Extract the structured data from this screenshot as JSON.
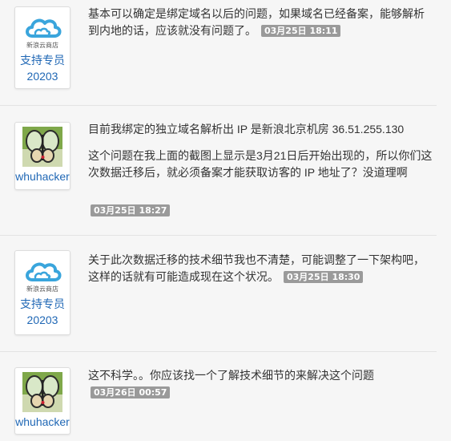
{
  "posts": [
    {
      "user": {
        "name": "支持专员",
        "id": "20203",
        "badge_text": "新浪云商店",
        "avatar": "sina-cloud-logo"
      },
      "paragraphs": [
        "基本可以确定是绑定域名以后的问题，如果域名已经备案，能够解析到内地的话，应该就没有问题了。"
      ],
      "timestamp": "03月25日 18:11"
    },
    {
      "user": {
        "name": "whuhacker",
        "avatar": "butterfly-photo"
      },
      "paragraphs": [
        "目前我绑定的独立域名解析出 IP 是新浪北京机房 36.51.255.130",
        "这个问题在我上面的截图上显示是3月21日后开始出现的，所以你们这次数据迁移后，就必须备案才能获取访客的 IP 地址了？没道理啊"
      ],
      "timestamp": "03月25日 18:27"
    },
    {
      "user": {
        "name": "支持专员",
        "id": "20203",
        "badge_text": "新浪云商店",
        "avatar": "sina-cloud-logo"
      },
      "paragraphs": [
        "关于此次数据迁移的技术细节我也不清楚，可能调整了一下架构吧，这样的话就有可能造成现在这个状况。"
      ],
      "timestamp": "03月25日 18:30"
    },
    {
      "user": {
        "name": "whuhacker",
        "avatar": "butterfly-photo"
      },
      "paragraphs": [
        "这不科学。。你应该找一个了解技术细节的来解决这个问题"
      ],
      "timestamp": "03月26日 00:57"
    }
  ],
  "colors": {
    "username": "#1f67b5",
    "timestamp_bg": "#9a9a9a",
    "cloud_blue": "#3aa5dc"
  }
}
